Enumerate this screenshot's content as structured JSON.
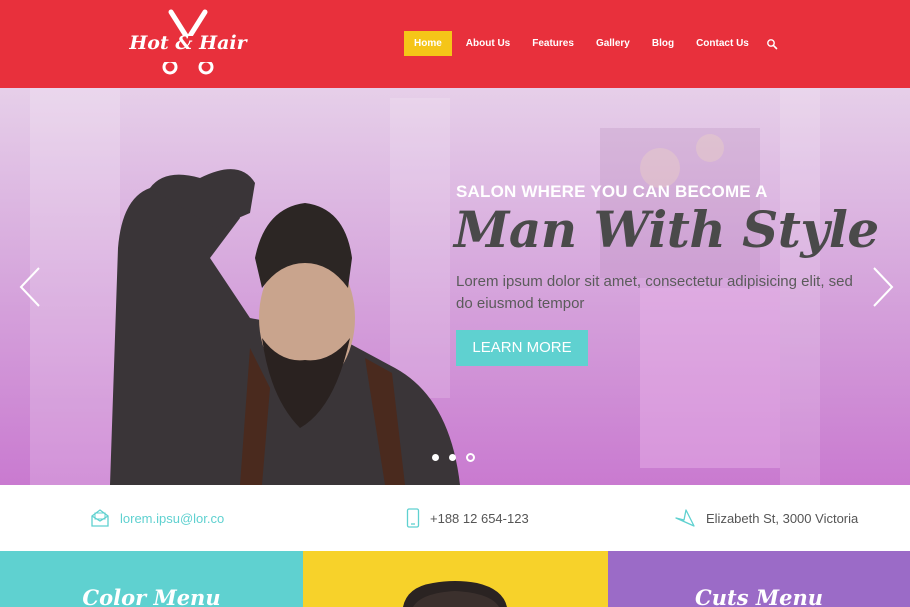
{
  "brand": {
    "name": "Hot & Hair"
  },
  "nav": {
    "items": [
      {
        "label": "Home",
        "active": true
      },
      {
        "label": "About Us"
      },
      {
        "label": "Features"
      },
      {
        "label": "Gallery"
      },
      {
        "label": "Blog"
      },
      {
        "label": "Contact Us"
      }
    ],
    "search_icon": "search-icon"
  },
  "hero": {
    "subtitle": "SALON WHERE YOU CAN BECOME A",
    "title": "Man With Style",
    "text": "Lorem ipsum dolor sit amet, consectetur adipisicing elit, sed do eiusmod tempor",
    "button_label": "LEARN MORE",
    "slides": {
      "count": 3,
      "active_index": 2
    }
  },
  "contact": {
    "email": "lorem.ipsu@lor.co",
    "phone": "+188 12 654-123",
    "address": "Elizabeth St, 3000 Victoria"
  },
  "tiles": {
    "left_title": "Color Menu",
    "right_title": "Cuts Menu"
  },
  "colors": {
    "header": "#e8303c",
    "nav_active": "#f5c518",
    "accent": "#5fd1d0",
    "purple": "#9b6bc7",
    "yellow": "#f7d22a"
  }
}
